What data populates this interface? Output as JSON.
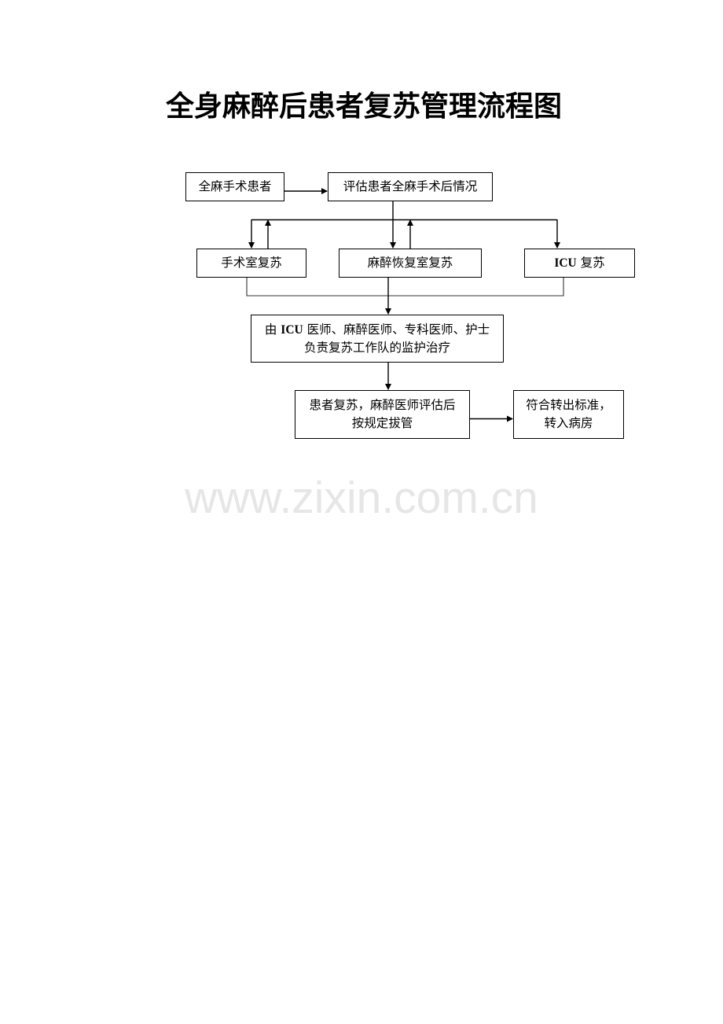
{
  "document": {
    "title": "全身麻醉后患者复苏管理流程图"
  },
  "flowchart": {
    "nodes": {
      "patient": {
        "label": "全麻手术患者"
      },
      "assess": {
        "label": "评估患者全麻手术后情况"
      },
      "operating_room": {
        "label": "手术室复苏"
      },
      "pacu": {
        "label": "麻醉恢复室复苏"
      },
      "icu": {
        "label_latin": "ICU",
        "label_rest": " 复苏"
      },
      "team": {
        "line1_prefix": "由 ",
        "line1_latin": "ICU",
        "line1_rest": " 医师、麻醉医师、专科医师、护士",
        "line2": "负责复苏工作队的监护治疗"
      },
      "extubate": {
        "line1": "患者复苏，麻醉医师评估后",
        "line2": "按规定拔管"
      },
      "transfer": {
        "line1": "符合转出标准，",
        "line2": "转入病房"
      }
    },
    "edges": [
      {
        "from": "patient",
        "to": "assess"
      },
      {
        "from": "assess",
        "to": "operating_room"
      },
      {
        "from": "assess",
        "to": "pacu"
      },
      {
        "from": "assess",
        "to": "icu"
      },
      {
        "from": "operating_room",
        "to": "assess"
      },
      {
        "from": "pacu",
        "to": "assess"
      },
      {
        "from": "operating_room",
        "to": "team"
      },
      {
        "from": "pacu",
        "to": "team"
      },
      {
        "from": "icu",
        "to": "team"
      },
      {
        "from": "team",
        "to": "extubate"
      },
      {
        "from": "extubate",
        "to": "transfer"
      }
    ]
  },
  "watermark": "www.zixin.com.cn"
}
